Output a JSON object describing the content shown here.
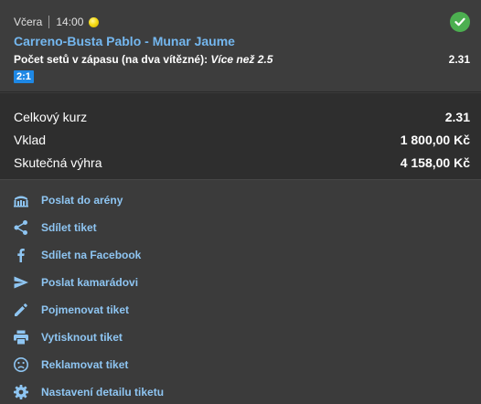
{
  "bet": {
    "day": "Včera",
    "time": "14:00",
    "match": "Carreno-Busta Pablo - Munar Jaume",
    "market_label": "Počet setů v zápasu (na dva vítězné):",
    "selection": "Více než 2.5",
    "odd": "2.31",
    "score": "2:1",
    "status_icon": "check-circle-icon",
    "status_color": "#4caf50"
  },
  "summary": {
    "total_odds_label": "Celkový kurz",
    "total_odds_value": "2.31",
    "stake_label": "Vklad",
    "stake_value": "1 800,00 Kč",
    "win_label": "Skutečná výhra",
    "win_value": "4 158,00 Kč"
  },
  "actions": [
    {
      "label": "Poslat do arény",
      "icon": "arena-icon"
    },
    {
      "label": "Sdílet tiket",
      "icon": "share-icon"
    },
    {
      "label": "Sdílet na Facebook",
      "icon": "facebook-icon"
    },
    {
      "label": "Poslat kamarádovi",
      "icon": "send-icon"
    },
    {
      "label": "Pojmenovat tiket",
      "icon": "pencil-icon"
    },
    {
      "label": "Vytisknout tiket",
      "icon": "print-icon"
    },
    {
      "label": "Reklamovat tiket",
      "icon": "sad-face-icon"
    },
    {
      "label": "Nastavení detailu tiketu",
      "icon": "gear-icon"
    }
  ],
  "colors": {
    "accent": "#74b7ef",
    "link": "#8ec5f2",
    "badge": "#1e88e5"
  }
}
